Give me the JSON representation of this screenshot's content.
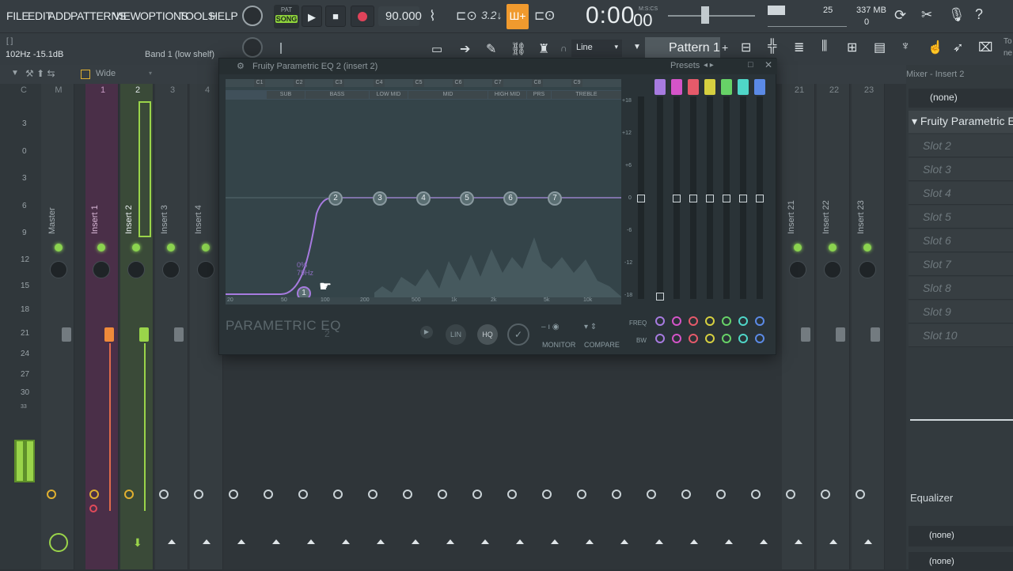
{
  "menu": {
    "items": [
      "FILE",
      "EDIT",
      "ADD",
      "PATTERNS",
      "VIEW",
      "OPTIONS",
      "TOOLS",
      "HELP"
    ]
  },
  "transport": {
    "pat_label": "PAT",
    "song_label": "SONG",
    "tempo": "90.000",
    "time": "0:00",
    "time_sub": "00",
    "time_fmt": "M:S:CS"
  },
  "perf": {
    "cpu": "25",
    "mem": "337 MB",
    "poly": "0"
  },
  "hint": {
    "bracket": "[ ]",
    "freq": "102Hz -15.1dB",
    "band": "Band 1 (low shelf)"
  },
  "toolbar": {
    "snap": "Line",
    "pattern": "Pattern 1",
    "to_label": "To",
    "ne_label": "ne"
  },
  "mixer": {
    "view_label": "Wide",
    "title": "Mixer - Insert 2",
    "headers": [
      "C",
      "M",
      "1",
      "2",
      "3",
      "4",
      "21",
      "22",
      "23"
    ],
    "strips": [
      "Master",
      "Insert 1",
      "Insert 2",
      "Insert 3",
      "Insert 4",
      "Insert 21",
      "Insert 22",
      "Insert 23"
    ],
    "db_scale": [
      "3",
      "0",
      "3",
      "6",
      "9",
      "12",
      "15",
      "18",
      "21",
      "24",
      "27",
      "30",
      "33"
    ]
  },
  "eq": {
    "title": "Fruity Parametric EQ 2 (insert 2)",
    "presets": "Presets",
    "notes": [
      "C1",
      "C2",
      "C3",
      "C4",
      "C5",
      "C6",
      "C7",
      "C8",
      "C9"
    ],
    "ranges": [
      "SUB",
      "BASS",
      "LOW MID",
      "MID",
      "HIGH MID",
      "PRS",
      "TREBLE"
    ],
    "db_labels": [
      "+18",
      "+12",
      "+6",
      "0",
      "-6",
      "-12",
      "-18"
    ],
    "freq_labels": [
      "20",
      "50",
      "100",
      "200",
      "500",
      "1k",
      "2k",
      "5k",
      "10k"
    ],
    "bands": [
      "1",
      "2",
      "3",
      "4",
      "5",
      "6",
      "7"
    ],
    "logo": "PARAMETRIC EQ",
    "logo_num": "2",
    "lin": "LIN",
    "hq": "HQ",
    "monitor": "MONITOR",
    "compare": "COMPARE",
    "freq_label": "FREQ",
    "bw_label": "BW",
    "cursor_val": "0%",
    "cursor_hz": "79Hz",
    "band_colors": [
      "#a77be0",
      "#d454c8",
      "#e55a6a",
      "#d6d040",
      "#67d267",
      "#4fd6c8",
      "#5b8ae6"
    ]
  },
  "rightpanel": {
    "preset": "(none)",
    "effect": "Fruity Parametric E",
    "slots": [
      "Slot 2",
      "Slot 3",
      "Slot 4",
      "Slot 5",
      "Slot 6",
      "Slot 7",
      "Slot 8",
      "Slot 9",
      "Slot 10"
    ],
    "eq_label": "Equalizer",
    "out1": "(none)",
    "out2": "(none)"
  }
}
